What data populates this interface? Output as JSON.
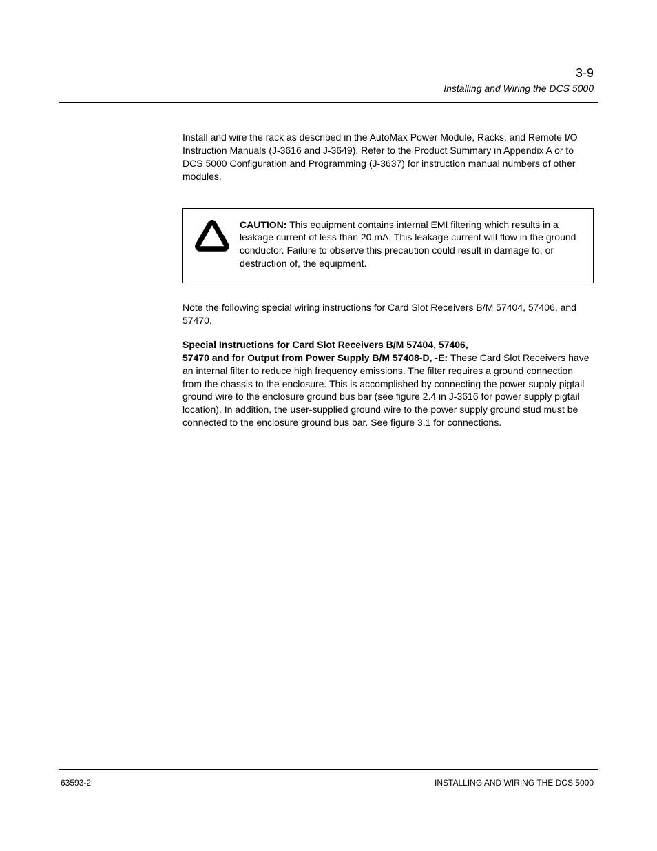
{
  "header": {
    "page_number": "3-9",
    "section": "Installing and Wiring the DCS 5000"
  },
  "content": {
    "para1": "Install and wire the rack as described in the AutoMax Power Module, Racks, and Remote I/O Instruction Manuals (J-3616 and J-3649). Refer to the Product Summary in Appendix A or to DCS 5000 Configuration and Programming (J-3637) for instruction manual numbers of other modules.",
    "note": {
      "label": "CAUTION:",
      "body": "This equipment contains internal EMI filtering which results in a leakage current of less than 20 mA. This leakage current will flow in the ground conductor. Failure to observe this precaution could result in damage to, or destruction of, the equipment."
    },
    "para2": "Note the following special wiring instructions for Card Slot Receivers B/M 57404, 57406, and 57470.",
    "special": {
      "line1_bold": "Special Instructions for Card Slot Receivers B/M 57404, 57406,",
      "line1_rest": "",
      "line2_bold": "57470 and for Output from Power Supply B/M 57408-D, -E: ",
      "line2_rest": "These Card Slot Receivers have an internal filter to reduce high frequency emissions. The filter requires a ground connection from the chassis to the enclosure. This is accomplished by connecting the power supply pigtail ground wire to the enclosure ground bus bar (see figure 2.4 in J-3616 for power supply pigtail location). In addition, the user-supplied ground wire to the power supply ground stud must be connected to the enclosure ground bus bar. See figure 3.1 for connections."
    }
  },
  "footer": {
    "left": "63593-2",
    "right": "INSTALLING AND WIRING THE DCS 5000"
  }
}
